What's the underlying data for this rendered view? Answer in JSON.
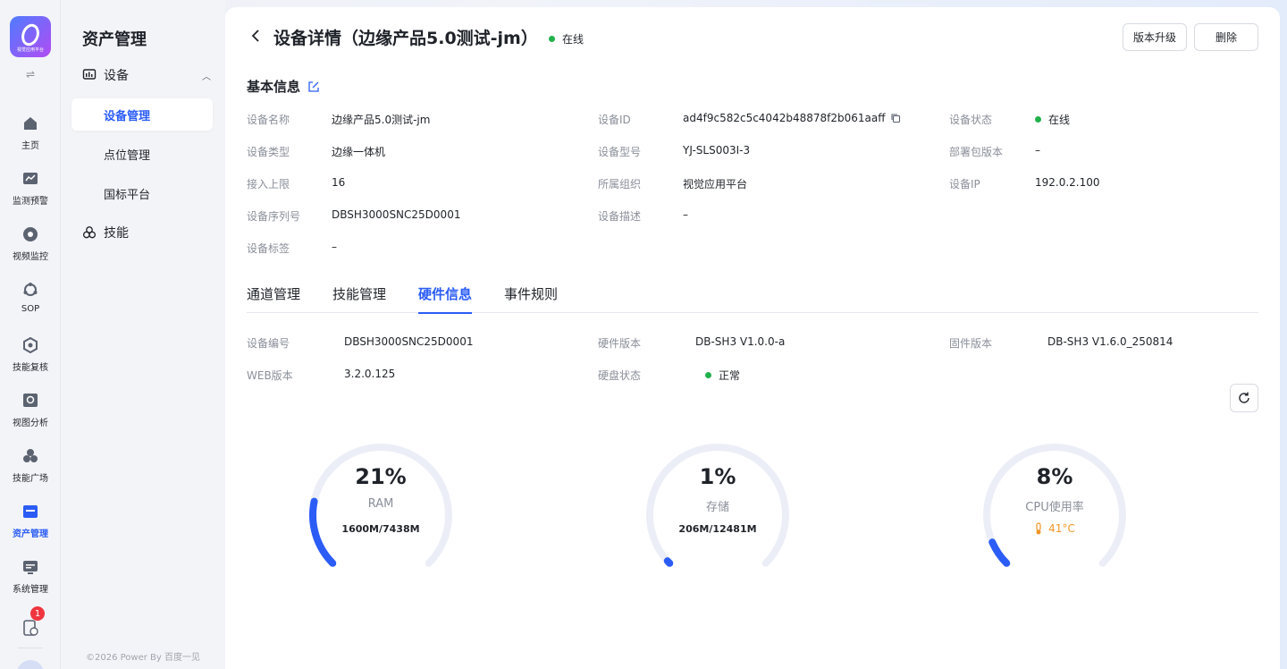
{
  "rail": {
    "logo_text": "视觉应用平台",
    "items": [
      {
        "label": "主页",
        "icon": "home-icon"
      },
      {
        "label": "监测预警",
        "icon": "chart-icon"
      },
      {
        "label": "视频监控",
        "icon": "camera-icon"
      },
      {
        "label": "SOP",
        "icon": "sop-icon"
      },
      {
        "label": "技能复核",
        "icon": "review-icon"
      },
      {
        "label": "视图分析",
        "icon": "analysis-icon"
      },
      {
        "label": "技能广场",
        "icon": "market-icon"
      },
      {
        "label": "资产管理",
        "icon": "asset-icon"
      },
      {
        "label": "系统管理",
        "icon": "system-icon"
      }
    ],
    "notification_count": "1",
    "accent": "#2b5cf6"
  },
  "sidebar": {
    "title": "资产管理",
    "group_device": "设备",
    "sub_items": [
      "设备管理",
      "点位管理",
      "国标平台"
    ],
    "group_skill": "技能",
    "footer": "©2026 Power By 百度一见"
  },
  "header": {
    "title": "设备详情（边缘产品5.0测试-jm）",
    "status": "在线",
    "upgrade_button": "版本升级",
    "delete_button": "删除"
  },
  "basic_info": {
    "title": "基本信息",
    "fields": {
      "name_label": "设备名称",
      "name_value": "边缘产品5.0测试-jm",
      "id_label": "设备ID",
      "id_value": "ad4f9c582c5c4042b48878f2b061aaff",
      "state_label": "设备状态",
      "state_value": "在线",
      "type_label": "设备类型",
      "type_value": "边缘一体机",
      "model_label": "设备型号",
      "model_value": "YJ-SLS003I-3",
      "pkg_label": "部署包版本",
      "pkg_value": "–",
      "limit_label": "接入上限",
      "limit_value": "16",
      "org_label": "所属组织",
      "org_value": "视觉应用平台",
      "ip_label": "设备IP",
      "ip_value": "192.0.2.100",
      "serial_label": "设备序列号",
      "serial_value": "DBSH3000SNC25D0001",
      "desc_label": "设备描述",
      "desc_value": "–",
      "tag_label": "设备标签",
      "tag_value": "–"
    }
  },
  "tabs": [
    {
      "label": "通道管理",
      "active": false
    },
    {
      "label": "技能管理",
      "active": false
    },
    {
      "label": "硬件信息",
      "active": true
    },
    {
      "label": "事件规则",
      "active": false
    }
  ],
  "hardware": {
    "code_label": "设备编号",
    "code_value": "DBSH3000SNC25D0001",
    "hw_label": "硬件版本",
    "hw_value": "DB-SH3 V1.0.0-a",
    "fw_label": "固件版本",
    "fw_value": "DB-SH3 V1.6.0_250814",
    "web_label": "WEB版本",
    "web_value": "3.2.0.125",
    "disk_label": "硬盘状态",
    "disk_value": "正常"
  },
  "gauges": [
    {
      "value_text": "21%",
      "percent": 21,
      "name": "RAM",
      "detail": "1600M/7438M"
    },
    {
      "value_text": "1%",
      "percent": 1,
      "name": "存储",
      "detail": "206M/12481M"
    },
    {
      "value_text": "8%",
      "percent": 8,
      "name": "CPU使用率",
      "temp": "41°C"
    }
  ],
  "colors": {
    "primary": "#2b5cf6",
    "online": "#22b14c",
    "track": "#eceef7",
    "temp": "#f0962a"
  }
}
